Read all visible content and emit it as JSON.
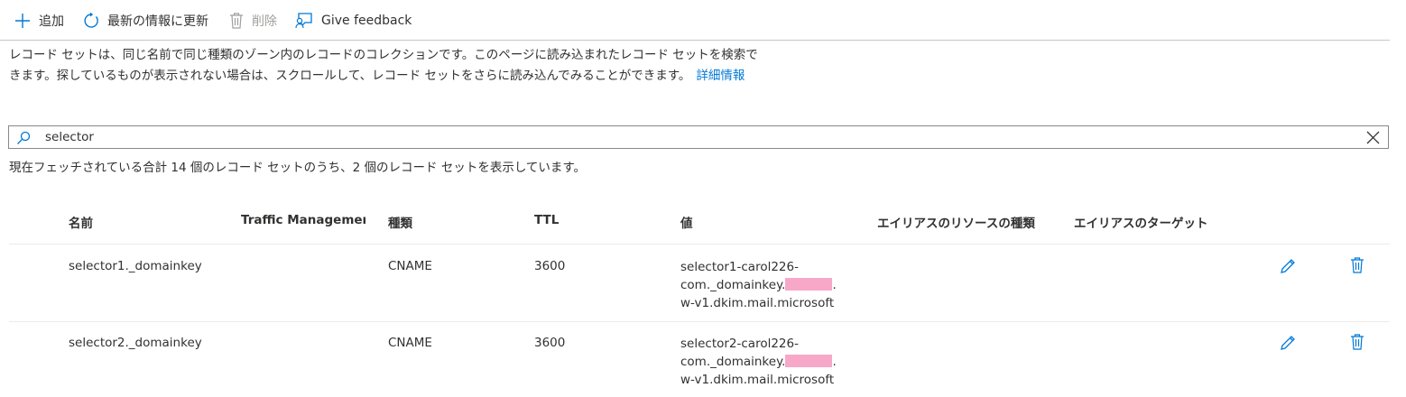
{
  "toolbar": {
    "add_label": "追加",
    "refresh_label": "最新の情報に更新",
    "delete_label": "削除",
    "feedback_label": "Give feedback"
  },
  "description": {
    "text": "レコード セットは、同じ名前で同じ種類のゾーン内のレコードのコレクションです。このページに読み込まれたレコード セットを検索できます。探しているものが表示されない場合は、スクロールして、レコード セットをさらに読み込んでみることができます。",
    "link": "詳細情報"
  },
  "search": {
    "value": "selector"
  },
  "result_count": "現在フェッチされている合計 14 個のレコード セットのうち、2 個のレコード セットを表示しています。",
  "columns": {
    "name": "名前",
    "traffic": "Traffic Management",
    "type": "種類",
    "ttl": "TTL",
    "value": "値",
    "alias_type": "エイリアスのリソースの種類",
    "alias_target": "エイリアスのターゲット"
  },
  "rows": [
    {
      "name": "selector1._domainkey",
      "type": "CNAME",
      "ttl": "3600",
      "value_line1": "selector1-carol226-",
      "value_line2a": "com._domainkey.",
      "value_line2b": ".",
      "value_line3": "w-v1.dkim.mail.microsoft"
    },
    {
      "name": "selector2._domainkey",
      "type": "CNAME",
      "ttl": "3600",
      "value_line1": "selector2-carol226-",
      "value_line2a": "com._domainkey.",
      "value_line2b": ".",
      "value_line3": "w-v1.dkim.mail.microsoft"
    }
  ],
  "colors": {
    "accent": "#0078d4",
    "text": "#323130",
    "disabled": "#a19f9d",
    "redaction": "#f7a8c8"
  }
}
